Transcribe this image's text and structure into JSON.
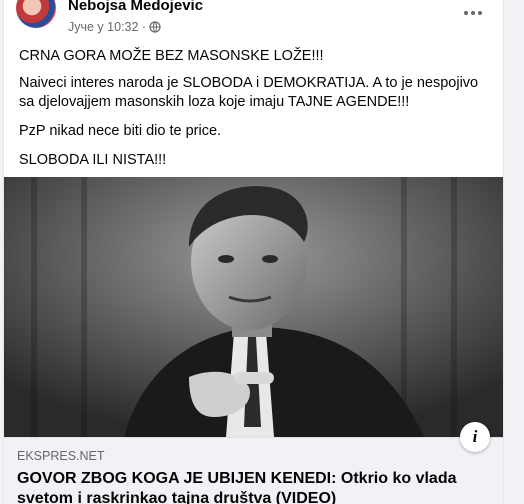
{
  "post": {
    "author": "Nebojsa Medojevic",
    "timestamp": "Јуче у 10:32 ·",
    "privacy_icon": "globe-icon",
    "more_icon": "more-options-icon",
    "paragraphs": [
      "CRNA GORA MOŽE BEZ MASONSKE LOŽE!!!",
      "Naiveci interes naroda je SLOBODA i DEMOKRATIJA. A to je nespojivo sa djelovajjem masonskih loza koje imaju TAJNE AGENDE!!!",
      "PzP nikad nece biti dio te price.",
      "SLOBODA ILI NISTA!!!"
    ]
  },
  "link_preview": {
    "domain": "EKSPRES.NET",
    "title": "GOVOR ZBOG KOGA JE UBIJEN KENEDI: Otkrio ko vlada svetom i raskrinkao tajna društva (VIDEO)",
    "info_label": "i"
  }
}
